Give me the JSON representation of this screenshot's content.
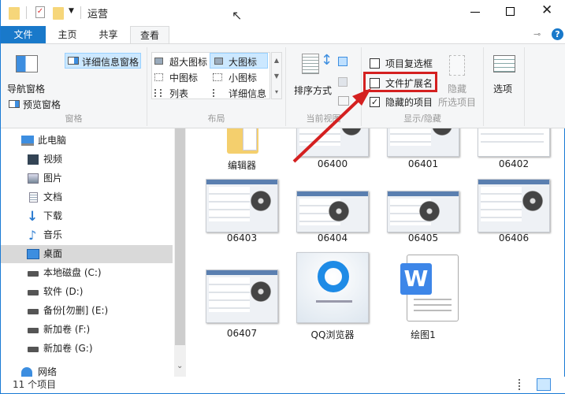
{
  "title_bar": {
    "title": "运营",
    "controls": {
      "minimize": "minimize-icon",
      "maximize": "maximize-icon",
      "close": "close-icon"
    }
  },
  "tabs": [
    {
      "label": "文件"
    },
    {
      "label": "主页"
    },
    {
      "label": "共享"
    },
    {
      "label": "查看"
    }
  ],
  "ribbon": {
    "panes": {
      "nav_pane": "导航窗格",
      "details_pane": "详细信息窗格",
      "preview_pane": "预览窗格",
      "group": "窗格"
    },
    "layout": {
      "items": [
        "超大图标",
        "大图标",
        "中图标",
        "小图标",
        "列表",
        "详细信息"
      ],
      "selected": "大图标",
      "group": "布局"
    },
    "current_view": {
      "sort": "排序方式",
      "group": "当前视图"
    },
    "show_hide": {
      "item_checkboxes": {
        "label": "项目复选框",
        "checked": false
      },
      "file_extensions": {
        "label": "文件扩展名",
        "checked": false
      },
      "hidden_items": {
        "label": "隐藏的项目",
        "checked": true
      },
      "hide_selected": [
        "隐藏",
        "所选项目"
      ],
      "group": "显示/隐藏"
    },
    "options": "选项"
  },
  "sidebar": {
    "items": [
      {
        "label": "此电脑"
      },
      {
        "label": "视频"
      },
      {
        "label": "图片"
      },
      {
        "label": "文档"
      },
      {
        "label": "下载"
      },
      {
        "label": "音乐"
      },
      {
        "label": "桌面"
      },
      {
        "label": "本地磁盘 (C:)"
      },
      {
        "label": "软件 (D:)"
      },
      {
        "label": "备份[勿删] (E:)"
      },
      {
        "label": "新加卷 (F:)"
      },
      {
        "label": "新加卷 (G:)"
      },
      {
        "label": "网络"
      }
    ],
    "selected": "桌面"
  },
  "files": [
    {
      "name": "编辑器"
    },
    {
      "name": "06400"
    },
    {
      "name": "06401"
    },
    {
      "name": "06402"
    },
    {
      "name": "06403"
    },
    {
      "name": "06404"
    },
    {
      "name": "06405"
    },
    {
      "name": "06406"
    },
    {
      "name": "06407"
    },
    {
      "name": "QQ浏览器"
    },
    {
      "name": "绘图1"
    }
  ],
  "status": {
    "count": "11 个项目"
  },
  "colors": {
    "accent": "#1979ca",
    "highlight": "#cce8ff",
    "annotation": "#d42020"
  }
}
